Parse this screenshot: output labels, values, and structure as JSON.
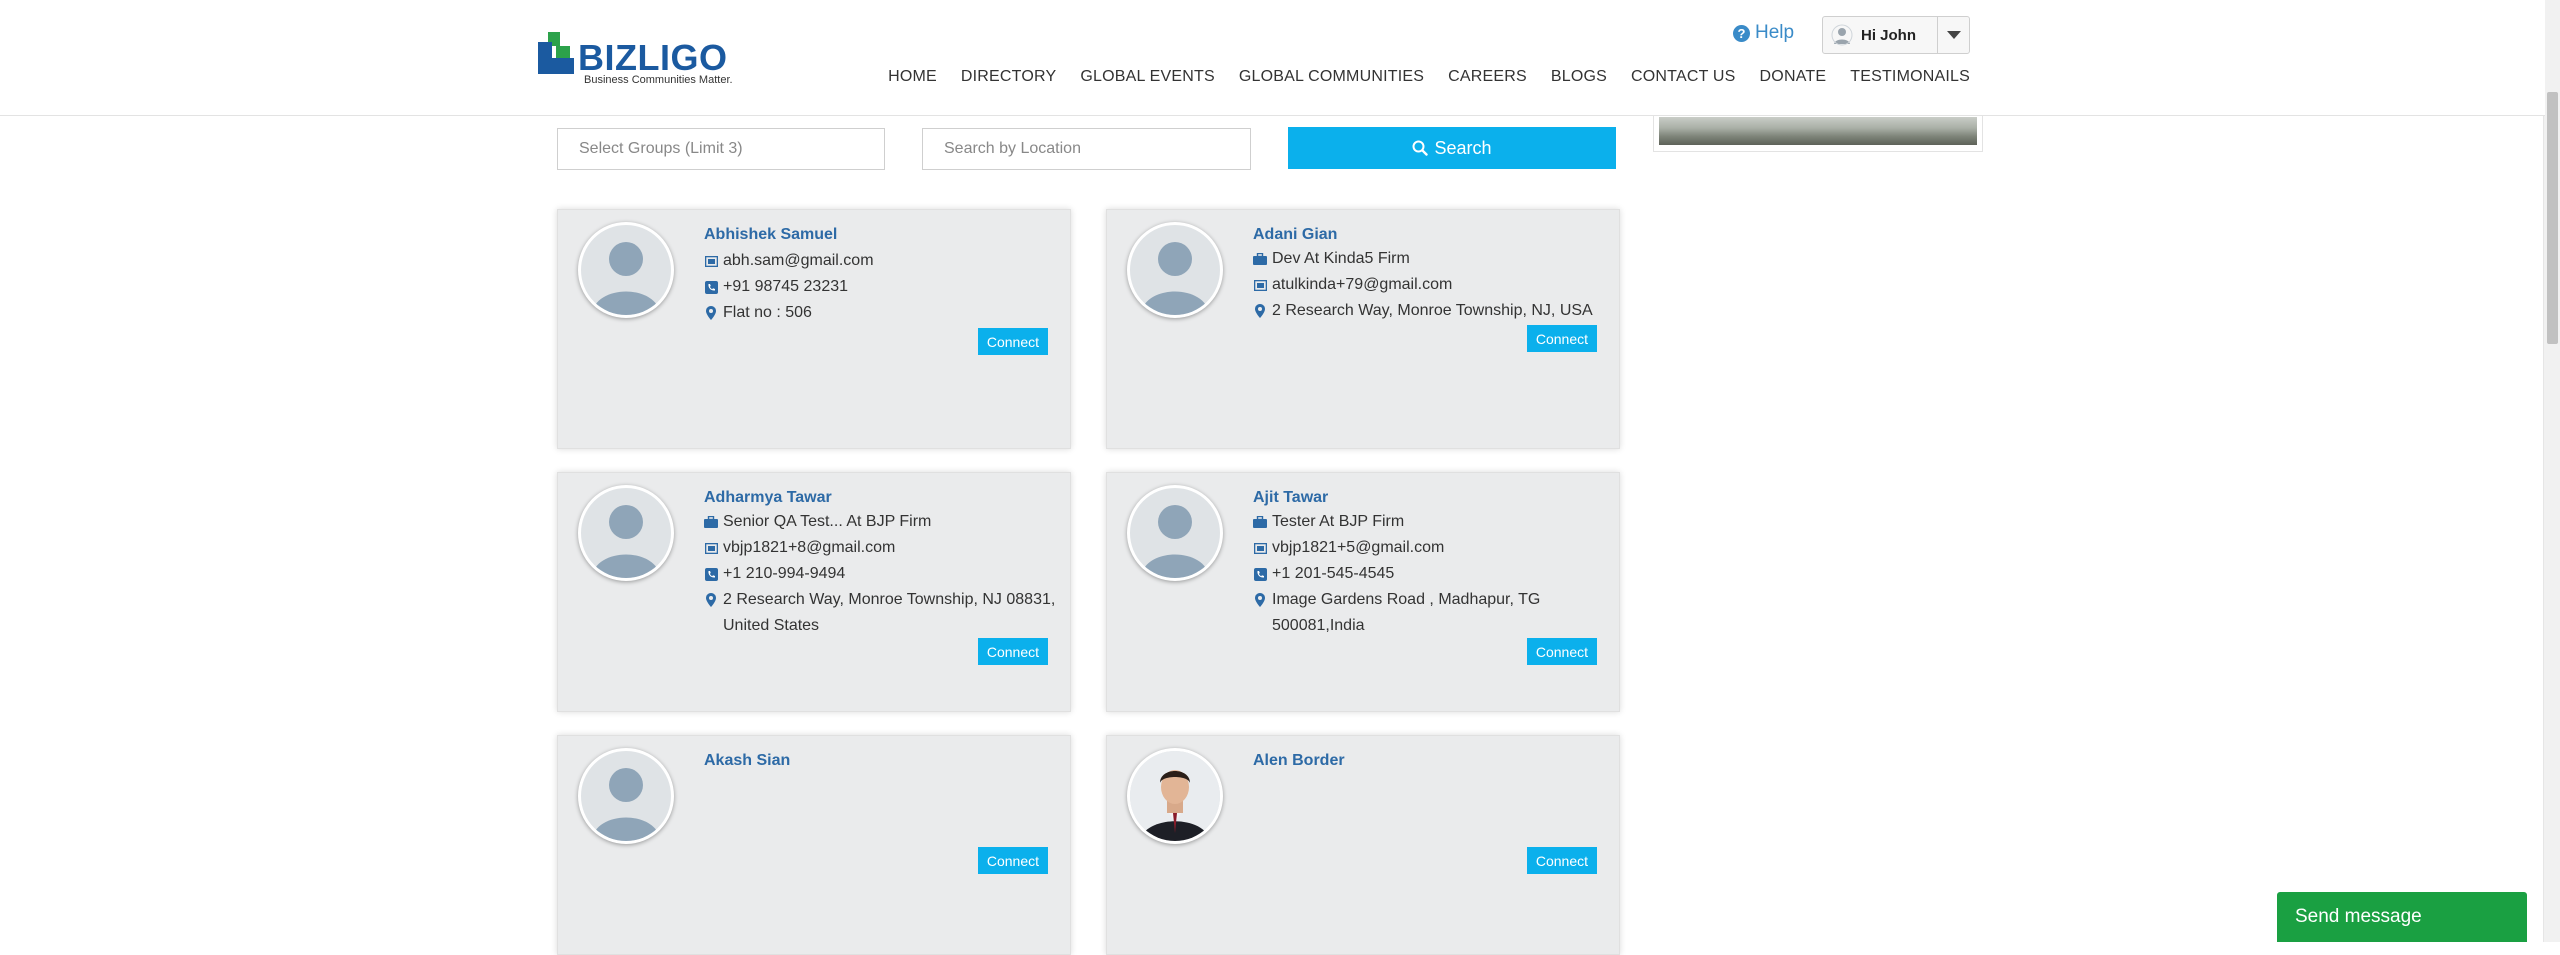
{
  "brand": {
    "name": "BIZLIGO",
    "tagline": "Business Communities Matter."
  },
  "header": {
    "help_label": "Help",
    "user_label": "Hi John",
    "nav": [
      "HOME",
      "DIRECTORY",
      "GLOBAL EVENTS",
      "GLOBAL COMMUNITIES",
      "CAREERS",
      "BLOGS",
      "CONTACT US",
      "DONATE",
      "TESTIMONAILS"
    ]
  },
  "filters": {
    "groups_placeholder": "Select Groups (Limit 3)",
    "location_placeholder": "Search by Location",
    "search_label": "Search"
  },
  "members": [
    {
      "name": "Abhishek Samuel",
      "lines": [
        {
          "icon": "envelope-icon",
          "text": "abh.sam@gmail.com"
        },
        {
          "icon": "phone-icon",
          "text": "+91 98745 23231"
        },
        {
          "icon": "map-marker-icon",
          "text": "Flat no : 506"
        }
      ],
      "connect": "Connect"
    },
    {
      "name": "Adani Gian",
      "lines": [
        {
          "icon": "briefcase-icon",
          "text": "Dev At Kinda5 Firm"
        },
        {
          "icon": "envelope-icon",
          "text": "atulkinda+79@gmail.com"
        },
        {
          "icon": "map-marker-icon",
          "text": "2 Research Way, Monroe Township, NJ, USA"
        }
      ],
      "connect": "Connect"
    },
    {
      "name": "Adharmya Tawar",
      "lines": [
        {
          "icon": "briefcase-icon",
          "text": "Senior QA Test... At BJP Firm"
        },
        {
          "icon": "envelope-icon",
          "text": "vbjp1821+8@gmail.com"
        },
        {
          "icon": "phone-icon",
          "text": "+1 210-994-9494"
        },
        {
          "icon": "map-marker-icon",
          "text": "2 Research Way, Monroe Township, NJ 08831, United States"
        }
      ],
      "connect": "Connect"
    },
    {
      "name": "Ajit Tawar",
      "lines": [
        {
          "icon": "briefcase-icon",
          "text": "Tester At BJP Firm"
        },
        {
          "icon": "envelope-icon",
          "text": "vbjp1821+5@gmail.com"
        },
        {
          "icon": "phone-icon",
          "text": "+1 201-545-4545"
        },
        {
          "icon": "map-marker-icon",
          "text": "Image Gardens Road , Madhapur, TG 500081,India"
        }
      ],
      "connect": "Connect"
    },
    {
      "name": "Akash Sian",
      "lines": [],
      "connect": "Connect"
    },
    {
      "name": "Alen Border",
      "lines": [],
      "connect": "Connect",
      "photo": true
    }
  ],
  "chat": {
    "label": "Send message"
  },
  "colors": {
    "accent": "#0bb0ec",
    "link": "#2d6aa6",
    "chat": "#1aa042",
    "brand": "#1b5aa0",
    "logo_green": "#2ca24b"
  }
}
